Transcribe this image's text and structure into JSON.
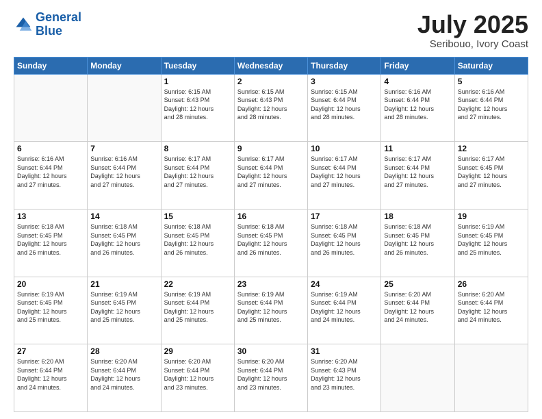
{
  "header": {
    "logo_line1": "General",
    "logo_line2": "Blue",
    "month_title": "July 2025",
    "location": "Seribouo, Ivory Coast"
  },
  "days_of_week": [
    "Sunday",
    "Monday",
    "Tuesday",
    "Wednesday",
    "Thursday",
    "Friday",
    "Saturday"
  ],
  "weeks": [
    [
      {
        "day": "",
        "info": ""
      },
      {
        "day": "",
        "info": ""
      },
      {
        "day": "1",
        "info": "Sunrise: 6:15 AM\nSunset: 6:43 PM\nDaylight: 12 hours\nand 28 minutes."
      },
      {
        "day": "2",
        "info": "Sunrise: 6:15 AM\nSunset: 6:43 PM\nDaylight: 12 hours\nand 28 minutes."
      },
      {
        "day": "3",
        "info": "Sunrise: 6:15 AM\nSunset: 6:44 PM\nDaylight: 12 hours\nand 28 minutes."
      },
      {
        "day": "4",
        "info": "Sunrise: 6:16 AM\nSunset: 6:44 PM\nDaylight: 12 hours\nand 28 minutes."
      },
      {
        "day": "5",
        "info": "Sunrise: 6:16 AM\nSunset: 6:44 PM\nDaylight: 12 hours\nand 27 minutes."
      }
    ],
    [
      {
        "day": "6",
        "info": "Sunrise: 6:16 AM\nSunset: 6:44 PM\nDaylight: 12 hours\nand 27 minutes."
      },
      {
        "day": "7",
        "info": "Sunrise: 6:16 AM\nSunset: 6:44 PM\nDaylight: 12 hours\nand 27 minutes."
      },
      {
        "day": "8",
        "info": "Sunrise: 6:17 AM\nSunset: 6:44 PM\nDaylight: 12 hours\nand 27 minutes."
      },
      {
        "day": "9",
        "info": "Sunrise: 6:17 AM\nSunset: 6:44 PM\nDaylight: 12 hours\nand 27 minutes."
      },
      {
        "day": "10",
        "info": "Sunrise: 6:17 AM\nSunset: 6:44 PM\nDaylight: 12 hours\nand 27 minutes."
      },
      {
        "day": "11",
        "info": "Sunrise: 6:17 AM\nSunset: 6:44 PM\nDaylight: 12 hours\nand 27 minutes."
      },
      {
        "day": "12",
        "info": "Sunrise: 6:17 AM\nSunset: 6:45 PM\nDaylight: 12 hours\nand 27 minutes."
      }
    ],
    [
      {
        "day": "13",
        "info": "Sunrise: 6:18 AM\nSunset: 6:45 PM\nDaylight: 12 hours\nand 26 minutes."
      },
      {
        "day": "14",
        "info": "Sunrise: 6:18 AM\nSunset: 6:45 PM\nDaylight: 12 hours\nand 26 minutes."
      },
      {
        "day": "15",
        "info": "Sunrise: 6:18 AM\nSunset: 6:45 PM\nDaylight: 12 hours\nand 26 minutes."
      },
      {
        "day": "16",
        "info": "Sunrise: 6:18 AM\nSunset: 6:45 PM\nDaylight: 12 hours\nand 26 minutes."
      },
      {
        "day": "17",
        "info": "Sunrise: 6:18 AM\nSunset: 6:45 PM\nDaylight: 12 hours\nand 26 minutes."
      },
      {
        "day": "18",
        "info": "Sunrise: 6:18 AM\nSunset: 6:45 PM\nDaylight: 12 hours\nand 26 minutes."
      },
      {
        "day": "19",
        "info": "Sunrise: 6:19 AM\nSunset: 6:45 PM\nDaylight: 12 hours\nand 25 minutes."
      }
    ],
    [
      {
        "day": "20",
        "info": "Sunrise: 6:19 AM\nSunset: 6:45 PM\nDaylight: 12 hours\nand 25 minutes."
      },
      {
        "day": "21",
        "info": "Sunrise: 6:19 AM\nSunset: 6:45 PM\nDaylight: 12 hours\nand 25 minutes."
      },
      {
        "day": "22",
        "info": "Sunrise: 6:19 AM\nSunset: 6:44 PM\nDaylight: 12 hours\nand 25 minutes."
      },
      {
        "day": "23",
        "info": "Sunrise: 6:19 AM\nSunset: 6:44 PM\nDaylight: 12 hours\nand 25 minutes."
      },
      {
        "day": "24",
        "info": "Sunrise: 6:19 AM\nSunset: 6:44 PM\nDaylight: 12 hours\nand 24 minutes."
      },
      {
        "day": "25",
        "info": "Sunrise: 6:20 AM\nSunset: 6:44 PM\nDaylight: 12 hours\nand 24 minutes."
      },
      {
        "day": "26",
        "info": "Sunrise: 6:20 AM\nSunset: 6:44 PM\nDaylight: 12 hours\nand 24 minutes."
      }
    ],
    [
      {
        "day": "27",
        "info": "Sunrise: 6:20 AM\nSunset: 6:44 PM\nDaylight: 12 hours\nand 24 minutes."
      },
      {
        "day": "28",
        "info": "Sunrise: 6:20 AM\nSunset: 6:44 PM\nDaylight: 12 hours\nand 24 minutes."
      },
      {
        "day": "29",
        "info": "Sunrise: 6:20 AM\nSunset: 6:44 PM\nDaylight: 12 hours\nand 23 minutes."
      },
      {
        "day": "30",
        "info": "Sunrise: 6:20 AM\nSunset: 6:44 PM\nDaylight: 12 hours\nand 23 minutes."
      },
      {
        "day": "31",
        "info": "Sunrise: 6:20 AM\nSunset: 6:43 PM\nDaylight: 12 hours\nand 23 minutes."
      },
      {
        "day": "",
        "info": ""
      },
      {
        "day": "",
        "info": ""
      }
    ]
  ]
}
